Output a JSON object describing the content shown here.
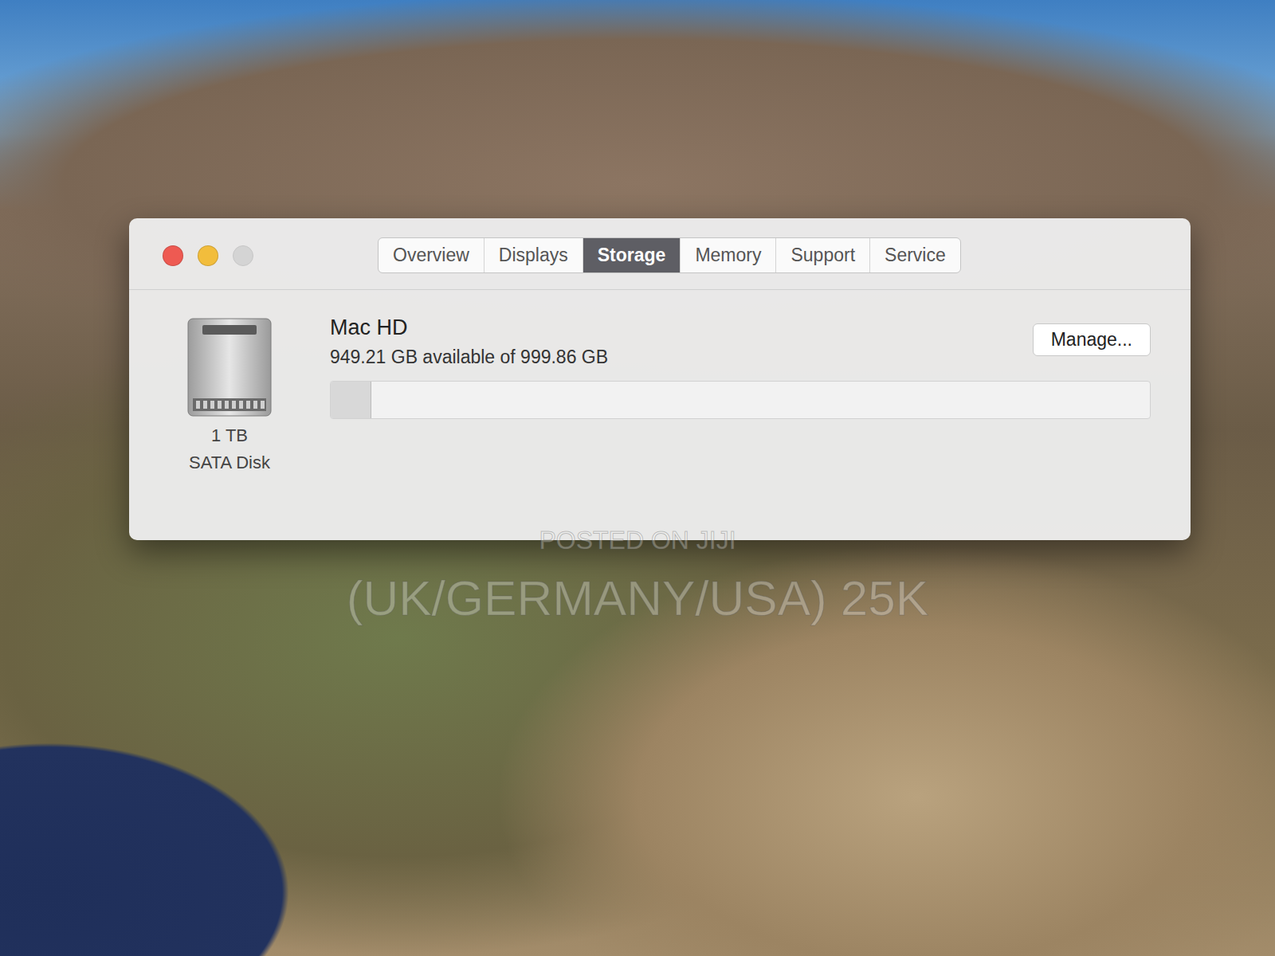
{
  "window": {
    "controls": [
      {
        "name": "close",
        "color": "#ee5a52",
        "disabled": false
      },
      {
        "name": "minimize",
        "color": "#f2bd3c",
        "disabled": false
      },
      {
        "name": "zoom",
        "color": "#d4d4d4",
        "disabled": true
      }
    ]
  },
  "tabs": [
    {
      "label": "Overview",
      "selected": false
    },
    {
      "label": "Displays",
      "selected": false
    },
    {
      "label": "Storage",
      "selected": true
    },
    {
      "label": "Memory",
      "selected": false
    },
    {
      "label": "Support",
      "selected": false
    },
    {
      "label": "Service",
      "selected": false
    }
  ],
  "disk": {
    "name": "Mac HD",
    "summary": "949.21 GB available of 999.86 GB",
    "capacity": "1 TB",
    "kind": "SATA Disk",
    "level": 0.05,
    "button": "Manage..."
  },
  "watermark": [
    "POSTED ON JIJI",
    "(UK/GERMANY/USA) 25K"
  ]
}
